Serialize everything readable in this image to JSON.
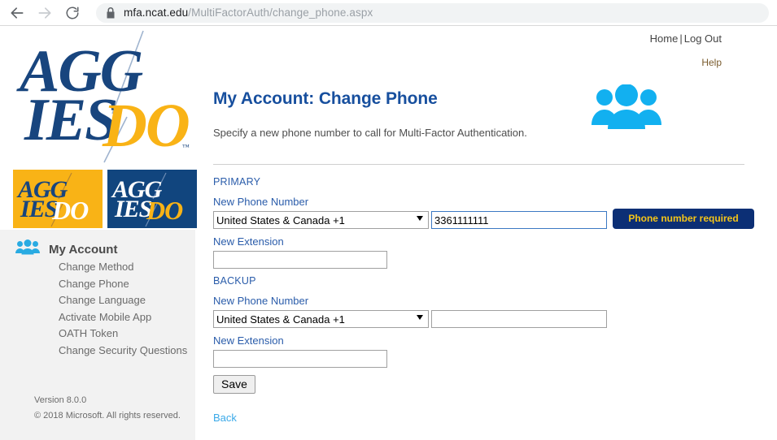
{
  "browser": {
    "url_domain": "mfa.ncat.edu",
    "url_path": "/MultiFactorAuth/change_phone.aspx",
    "back_icon": "back-arrow-icon",
    "forward_icon": "forward-arrow-icon",
    "reload_icon": "reload-icon",
    "lock_icon": "lock-icon"
  },
  "header": {
    "home_label": "Home",
    "separator": "|",
    "logout_label": "Log Out",
    "help_label": "Help"
  },
  "brand": {
    "line1": "AGG",
    "line2": "IES",
    "line3": "DO",
    "colors": {
      "blue": "#11457e",
      "gold": "#f9b316"
    }
  },
  "logo_tiles": [
    {
      "name": "aggies-do-gold-tile",
      "bg": "#f9b316",
      "aggies_color": "#11457e",
      "do_color": "#ffffff"
    },
    {
      "name": "aggies-do-blue-tile",
      "bg": "#11457e",
      "aggies_color": "#ffffff",
      "do_color": "#f9b316"
    }
  ],
  "sidebar": {
    "icon": "people-group-icon",
    "heading": "My Account",
    "items": [
      {
        "label": "Change Method"
      },
      {
        "label": "Change Phone"
      },
      {
        "label": "Change Language"
      },
      {
        "label": "Activate Mobile App"
      },
      {
        "label": "OATH Token"
      },
      {
        "label": "Change Security Questions"
      }
    ],
    "version": "Version 8.0.0",
    "copyright": "© 2018 Microsoft. All rights reserved."
  },
  "main": {
    "title": "My Account: Change Phone",
    "subtitle": "Specify a new phone number to call for Multi-Factor Authentication.",
    "header_icon": "people-group-icon",
    "accent_color": "#174f9e",
    "primary": {
      "section_label": "PRIMARY",
      "phone_label": "New Phone Number",
      "country_value": "United States & Canada +1",
      "phone_value": "3361111111",
      "phone_placeholder": "",
      "extension_label": "New Extension",
      "extension_value": "",
      "extension_placeholder": "",
      "validation_badge": "Phone number required",
      "badge_bg": "#0c2f75",
      "badge_fg": "#f5c518"
    },
    "backup": {
      "section_label": "BACKUP",
      "phone_label": "New Phone Number",
      "country_value": "United States & Canada +1",
      "phone_value": "",
      "phone_placeholder": "",
      "extension_label": "New Extension",
      "extension_value": "",
      "extension_placeholder": ""
    },
    "save_label": "Save",
    "back_label": "Back"
  }
}
